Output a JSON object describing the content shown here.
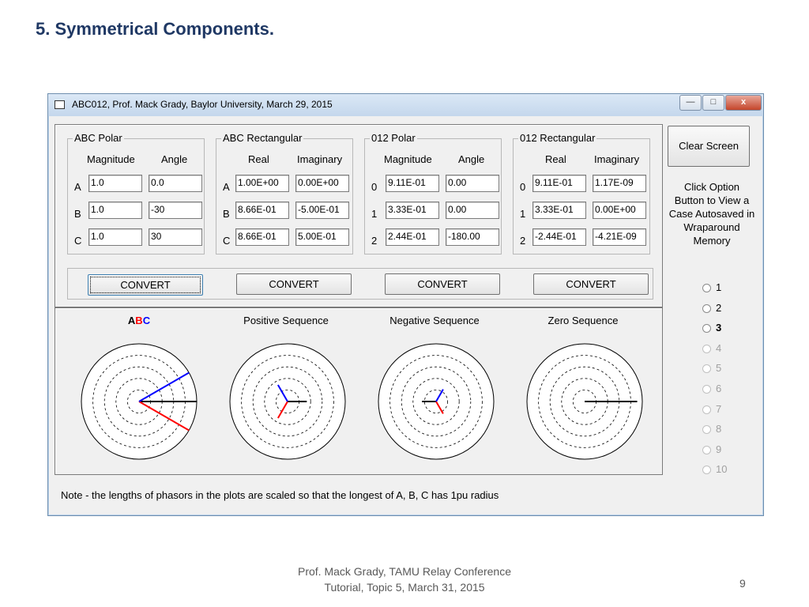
{
  "slide": {
    "title": "5.  Symmetrical Components.",
    "footer_line1": "Prof. Mack Grady, TAMU Relay Conference",
    "footer_line2": "Tutorial, Topic 5, March 31, 2015",
    "page_number": "9"
  },
  "window": {
    "title": "ABC012, Prof. Mack Grady, Baylor University, March 29, 2015",
    "minimize_icon": "minimize-icon",
    "maximize_icon": "maximize-icon",
    "close_label": "x"
  },
  "groups": {
    "abc_polar": {
      "label": "ABC Polar",
      "col1": "Magnitude",
      "col2": "Angle",
      "rows": [
        {
          "label": "A",
          "v1": "1.0",
          "v2": "0.0"
        },
        {
          "label": "B",
          "v1": "1.0",
          "v2": "-30"
        },
        {
          "label": "C",
          "v1": "1.0",
          "v2": "30"
        }
      ]
    },
    "abc_rect": {
      "label": "ABC Rectangular",
      "col1": "Real",
      "col2": "Imaginary",
      "rows": [
        {
          "label": "A",
          "v1": "1.00E+00",
          "v2": "0.00E+00"
        },
        {
          "label": "B",
          "v1": "8.66E-01",
          "v2": "-5.00E-01"
        },
        {
          "label": "C",
          "v1": "8.66E-01",
          "v2": "5.00E-01"
        }
      ]
    },
    "s012_polar": {
      "label": "012 Polar",
      "col1": "Magnitude",
      "col2": "Angle",
      "rows": [
        {
          "label": "0",
          "v1": "9.11E-01",
          "v2": "0.00"
        },
        {
          "label": "1",
          "v1": "3.33E-01",
          "v2": "0.00"
        },
        {
          "label": "2",
          "v1": "2.44E-01",
          "v2": "-180.00"
        }
      ]
    },
    "s012_rect": {
      "label": "012 Rectangular",
      "col1": "Real",
      "col2": "Imaginary",
      "rows": [
        {
          "label": "0",
          "v1": "9.11E-01",
          "v2": "1.17E-09"
        },
        {
          "label": "1",
          "v1": "3.33E-01",
          "v2": "0.00E+00"
        },
        {
          "label": "2",
          "v1": "-2.44E-01",
          "v2": "-4.21E-09"
        }
      ]
    }
  },
  "convert_label": "CONVERT",
  "clear_screen_label": "Clear Screen",
  "side_text": "Click Option Button to View a Case Autosaved in Wraparound Memory",
  "options": [
    {
      "label": "1",
      "enabled": true,
      "selected": false
    },
    {
      "label": "2",
      "enabled": true,
      "selected": false
    },
    {
      "label": "3",
      "enabled": true,
      "selected": false
    },
    {
      "label": "4",
      "enabled": false,
      "selected": false
    },
    {
      "label": "5",
      "enabled": false,
      "selected": false
    },
    {
      "label": "6",
      "enabled": false,
      "selected": false
    },
    {
      "label": "7",
      "enabled": false,
      "selected": false
    },
    {
      "label": "8",
      "enabled": false,
      "selected": false
    },
    {
      "label": "9",
      "enabled": false,
      "selected": false
    },
    {
      "label": "10",
      "enabled": false,
      "selected": false
    }
  ],
  "plots": {
    "abc": {
      "a": "A",
      "b": "B",
      "c": "C",
      "color_a": "#000000",
      "color_b": "#ff0000",
      "color_c": "#0000ff"
    },
    "positive_title": "Positive Sequence",
    "negative_title": "Negative Sequence",
    "zero_title": "Zero Sequence"
  },
  "phasors": {
    "abc": [
      {
        "mag": 1.0,
        "angle": 0,
        "color": "#000000"
      },
      {
        "mag": 1.0,
        "angle": -30,
        "color": "#ff0000"
      },
      {
        "mag": 1.0,
        "angle": 30,
        "color": "#0000ff"
      }
    ],
    "positive": [
      {
        "mag": 0.333,
        "angle": 0,
        "color": "#000000"
      },
      {
        "mag": 0.333,
        "angle": -120,
        "color": "#ff0000"
      },
      {
        "mag": 0.333,
        "angle": 120,
        "color": "#0000ff"
      }
    ],
    "negative": [
      {
        "mag": 0.244,
        "angle": 180,
        "color": "#000000"
      },
      {
        "mag": 0.244,
        "angle": -60,
        "color": "#ff0000"
      },
      {
        "mag": 0.244,
        "angle": 60,
        "color": "#0000ff"
      }
    ],
    "zero": [
      {
        "mag": 0.911,
        "angle": 0,
        "color": "#000000"
      }
    ]
  },
  "note": "Note - the lengths of phasors in the plots are scaled so that the longest of A, B, C has 1pu radius"
}
